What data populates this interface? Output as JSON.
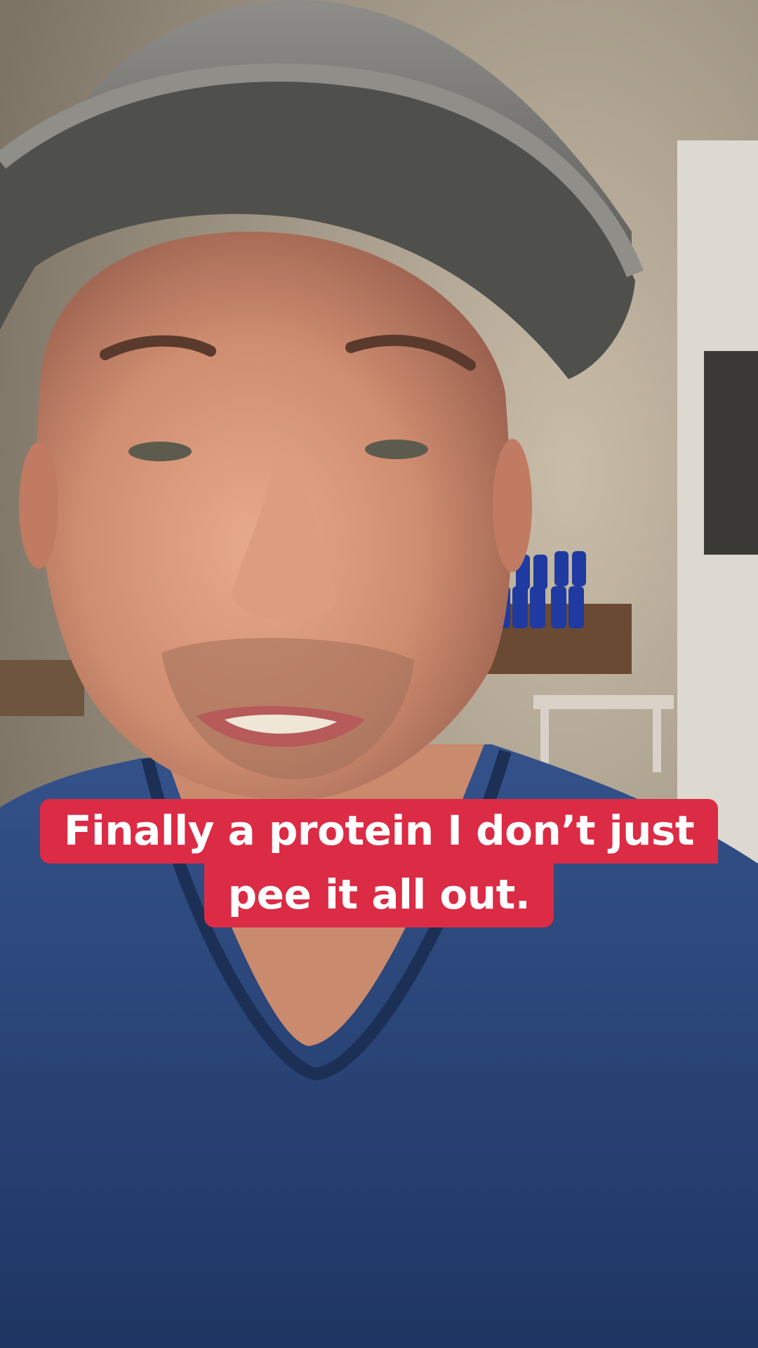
{
  "caption": {
    "line1": "Finally a protein I don’t just",
    "line2": "pee it all out."
  },
  "colors": {
    "caption_background": "#dc2b45",
    "caption_text": "#ffffff",
    "shirt": "#2a4473",
    "cap": "#6b6b6b",
    "skin": "#c98a6e",
    "wall": "#b8ab98"
  }
}
